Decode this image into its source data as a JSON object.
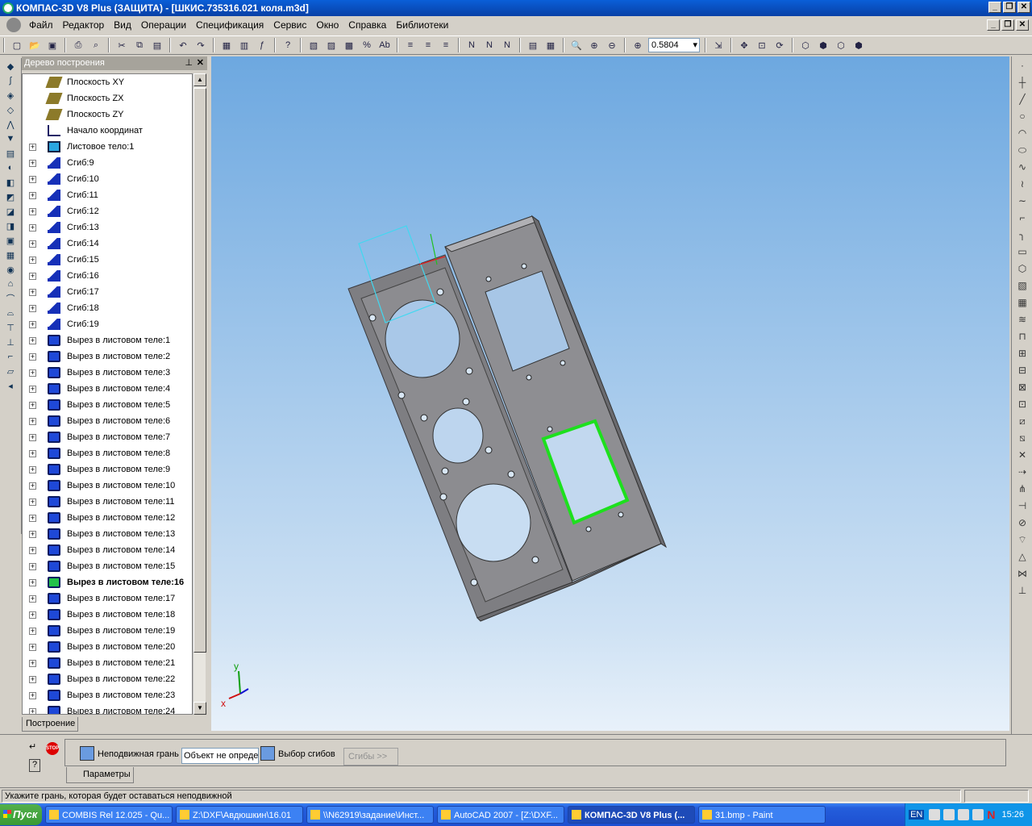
{
  "window": {
    "title": "КОМПАС-3D V8 Plus (ЗАЩИТА) - [ШКИС.735316.021 коля.m3d]",
    "controls": [
      "_",
      "❐",
      "✕"
    ]
  },
  "menu": [
    "Файл",
    "Редактор",
    "Вид",
    "Операции",
    "Спецификация",
    "Сервис",
    "Окно",
    "Справка",
    "Библиотеки"
  ],
  "toolbar": {
    "zoom_value": "0.5804"
  },
  "tree": {
    "title": "Дерево построения",
    "tab_label": "Построение",
    "items": [
      {
        "label": "Плоскость XY",
        "icon": "plane-icon",
        "expand": false
      },
      {
        "label": "Плоскость ZX",
        "icon": "plane-icon",
        "expand": false
      },
      {
        "label": "Плоскость ZY",
        "icon": "plane-icon",
        "expand": false
      },
      {
        "label": "Начало координат",
        "icon": "axis-icon",
        "expand": false
      },
      {
        "label": "Листовое тело:1",
        "icon": "sheet-icon",
        "expand": true
      },
      {
        "label": "Сгиб:9",
        "icon": "bend-icon",
        "expand": true
      },
      {
        "label": "Сгиб:10",
        "icon": "bend-icon",
        "expand": true
      },
      {
        "label": "Сгиб:11",
        "icon": "bend-icon",
        "expand": true
      },
      {
        "label": "Сгиб:12",
        "icon": "bend-icon",
        "expand": true
      },
      {
        "label": "Сгиб:13",
        "icon": "bend-icon",
        "expand": true
      },
      {
        "label": "Сгиб:14",
        "icon": "bend-icon",
        "expand": true
      },
      {
        "label": "Сгиб:15",
        "icon": "bend-icon",
        "expand": true
      },
      {
        "label": "Сгиб:16",
        "icon": "bend-icon",
        "expand": true
      },
      {
        "label": "Сгиб:17",
        "icon": "bend-icon",
        "expand": true
      },
      {
        "label": "Сгиб:18",
        "icon": "bend-icon",
        "expand": true
      },
      {
        "label": "Сгиб:19",
        "icon": "bend-icon",
        "expand": true
      },
      {
        "label": "Вырез в листовом теле:1",
        "icon": "cut-icon",
        "expand": true
      },
      {
        "label": "Вырез в листовом теле:2",
        "icon": "cut-icon",
        "expand": true
      },
      {
        "label": "Вырез в листовом теле:3",
        "icon": "cut-icon",
        "expand": true
      },
      {
        "label": "Вырез в листовом теле:4",
        "icon": "cut-icon",
        "expand": true
      },
      {
        "label": "Вырез в листовом теле:5",
        "icon": "cut-icon",
        "expand": true
      },
      {
        "label": "Вырез в листовом теле:6",
        "icon": "cut-icon",
        "expand": true
      },
      {
        "label": "Вырез в листовом теле:7",
        "icon": "cut-icon",
        "expand": true
      },
      {
        "label": "Вырез в листовом теле:8",
        "icon": "cut-icon",
        "expand": true
      },
      {
        "label": "Вырез в листовом теле:9",
        "icon": "cut-icon",
        "expand": true
      },
      {
        "label": "Вырез в листовом теле:10",
        "icon": "cut-icon",
        "expand": true
      },
      {
        "label": "Вырез в листовом теле:11",
        "icon": "cut-icon",
        "expand": true
      },
      {
        "label": "Вырез в листовом теле:12",
        "icon": "cut-icon",
        "expand": true
      },
      {
        "label": "Вырез в листовом теле:13",
        "icon": "cut-icon",
        "expand": true
      },
      {
        "label": "Вырез в листовом теле:14",
        "icon": "cut-icon",
        "expand": true
      },
      {
        "label": "Вырез в листовом теле:15",
        "icon": "cut-icon",
        "expand": true
      },
      {
        "label": "Вырез в листовом теле:16",
        "icon": "cut-icon-green",
        "expand": true,
        "bold": true
      },
      {
        "label": "Вырез в листовом теле:17",
        "icon": "cut-icon",
        "expand": true
      },
      {
        "label": "Вырез в листовом теле:18",
        "icon": "cut-icon",
        "expand": true
      },
      {
        "label": "Вырез в листовом теле:19",
        "icon": "cut-icon",
        "expand": true
      },
      {
        "label": "Вырез в листовом теле:20",
        "icon": "cut-icon",
        "expand": true
      },
      {
        "label": "Вырез в листовом теле:21",
        "icon": "cut-icon",
        "expand": true
      },
      {
        "label": "Вырез в листовом теле:22",
        "icon": "cut-icon",
        "expand": true
      },
      {
        "label": "Вырез в листовом теле:23",
        "icon": "cut-icon",
        "expand": true
      },
      {
        "label": "Вырез в листовом теле:24",
        "icon": "cut-icon",
        "expand": true
      }
    ]
  },
  "viewport": {
    "axis_y": "y",
    "axis_x": "x",
    "colors": {
      "bg_top": "#6da8e0",
      "part": "#8c8c8e",
      "highlight": "#1de01d",
      "sketch": "#40d8f0"
    }
  },
  "property_bar": {
    "fixed_face_label": "Неподвижная грань",
    "object_value": "Объект не определен",
    "bend_select_label": "Выбор сгибов",
    "bends_button": "Сгибы >>",
    "tab_label": "Параметры"
  },
  "status": {
    "message": "Укажите грань, которая будет оставаться неподвижной"
  },
  "taskbar": {
    "start_label": "Пуск",
    "tasks": [
      {
        "label": "COMBIS Rel 12.025 - Qu...",
        "active": false
      },
      {
        "label": "Z:\\DXF\\Авдюшкин\\16.01",
        "active": false
      },
      {
        "label": "\\\\N62919\\задание\\Инст...",
        "active": false
      },
      {
        "label": "AutoCAD 2007 - [Z:\\DXF...",
        "active": false
      },
      {
        "label": "КОМПАС-3D V8 Plus (...",
        "active": true
      },
      {
        "label": "31.bmp - Paint",
        "active": false
      }
    ],
    "lang": "EN",
    "clock": "15:26"
  }
}
